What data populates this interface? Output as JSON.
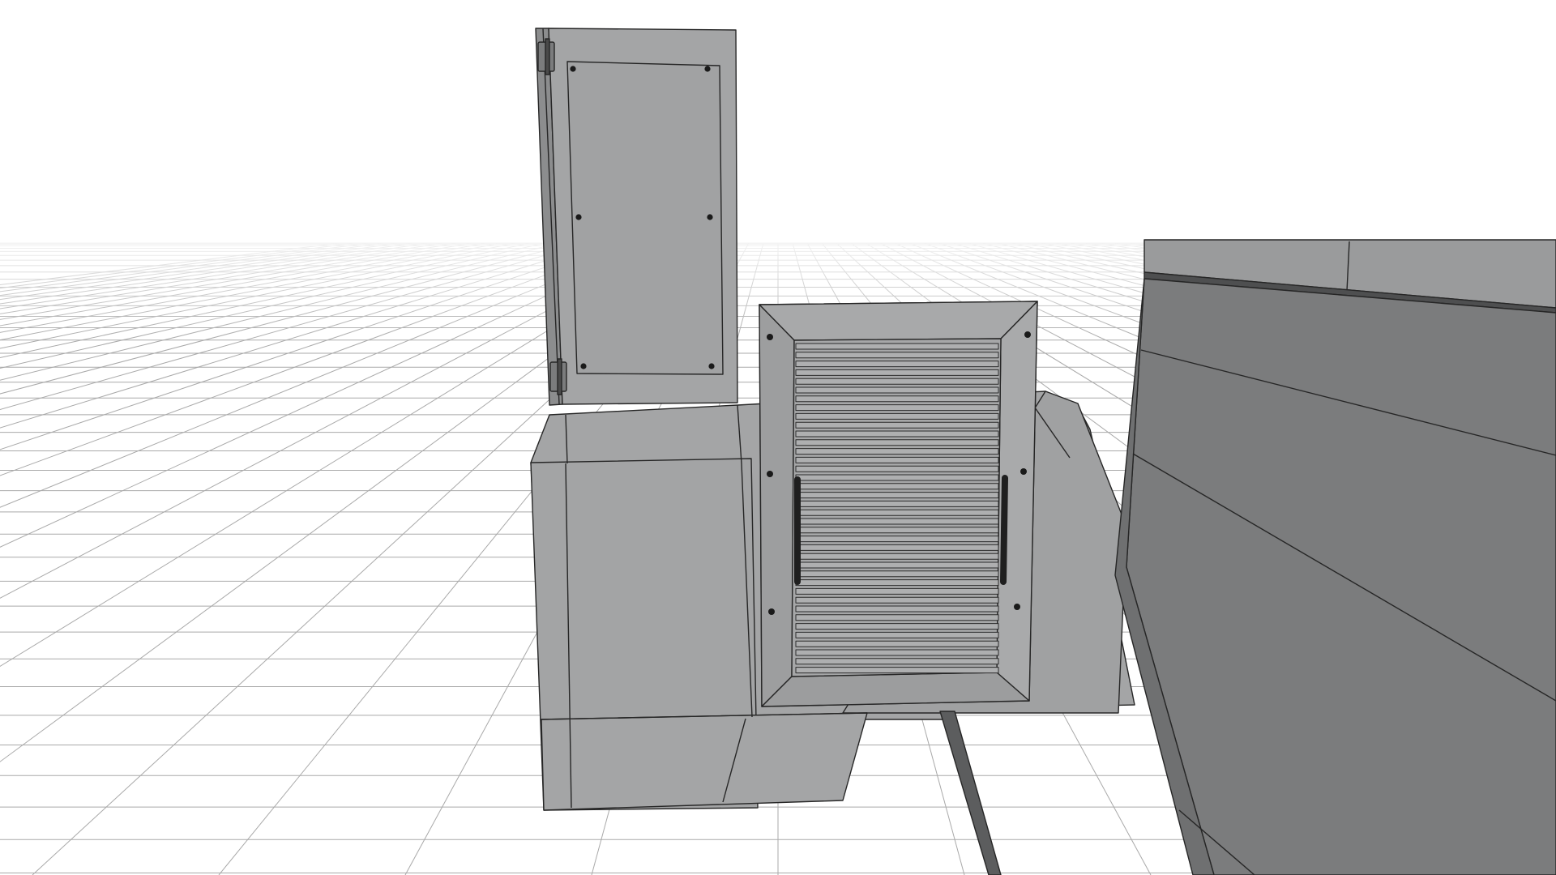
{
  "viewport": {
    "background": "#ffffff",
    "grid_color": "#9a9a9a",
    "model_colors": {
      "light_face": "#a4a5a6",
      "mid_face": "#9a9b9c",
      "dark_face": "#7b7c7d",
      "darker_face": "#6f7071",
      "edge": "#262626",
      "fastener": "#1a1a1a"
    },
    "objects": [
      {
        "name": "hinged-access-door-open",
        "kind": "door-panel"
      },
      {
        "name": "door-hinge",
        "kind": "hinge"
      },
      {
        "name": "louvered-grille-panel",
        "kind": "grille"
      },
      {
        "name": "pull-handle",
        "kind": "handle"
      },
      {
        "name": "enclosure-box",
        "kind": "box"
      },
      {
        "name": "large-housing",
        "kind": "box"
      },
      {
        "name": "ground-grid",
        "kind": "floor"
      }
    ]
  }
}
